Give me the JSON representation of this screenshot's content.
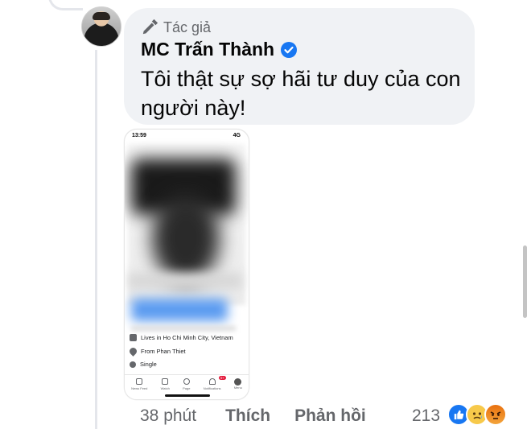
{
  "comment": {
    "author_badge": "Tác giả",
    "author_name": "MC Trấn Thành",
    "text": "Tôi thật sự sợ hãi tư duy của con người này!"
  },
  "attachment": {
    "status_time": "13:59",
    "status_network": "4G",
    "info": {
      "lives_prefix": "Lives in",
      "lives_place": "Ho Chi Minh City, Vietnam",
      "from_prefix": "From",
      "from_place": "Phan Thiet",
      "relationship": "Single"
    },
    "tabs": [
      {
        "label": "News Feed"
      },
      {
        "label": "Watch"
      },
      {
        "label": "Page"
      },
      {
        "label": "Notifications",
        "badge": "9+"
      },
      {
        "label": "Menu"
      }
    ]
  },
  "actions": {
    "time": "38 phút",
    "like": "Thích",
    "reply": "Phản hồi",
    "reaction_count": "213"
  },
  "reactions": [
    "like-icon",
    "sad-icon",
    "angry-icon"
  ],
  "colors": {
    "bubble_bg": "#f0f2f5",
    "verified": "#1877f2",
    "secondary_text": "#65676b"
  }
}
